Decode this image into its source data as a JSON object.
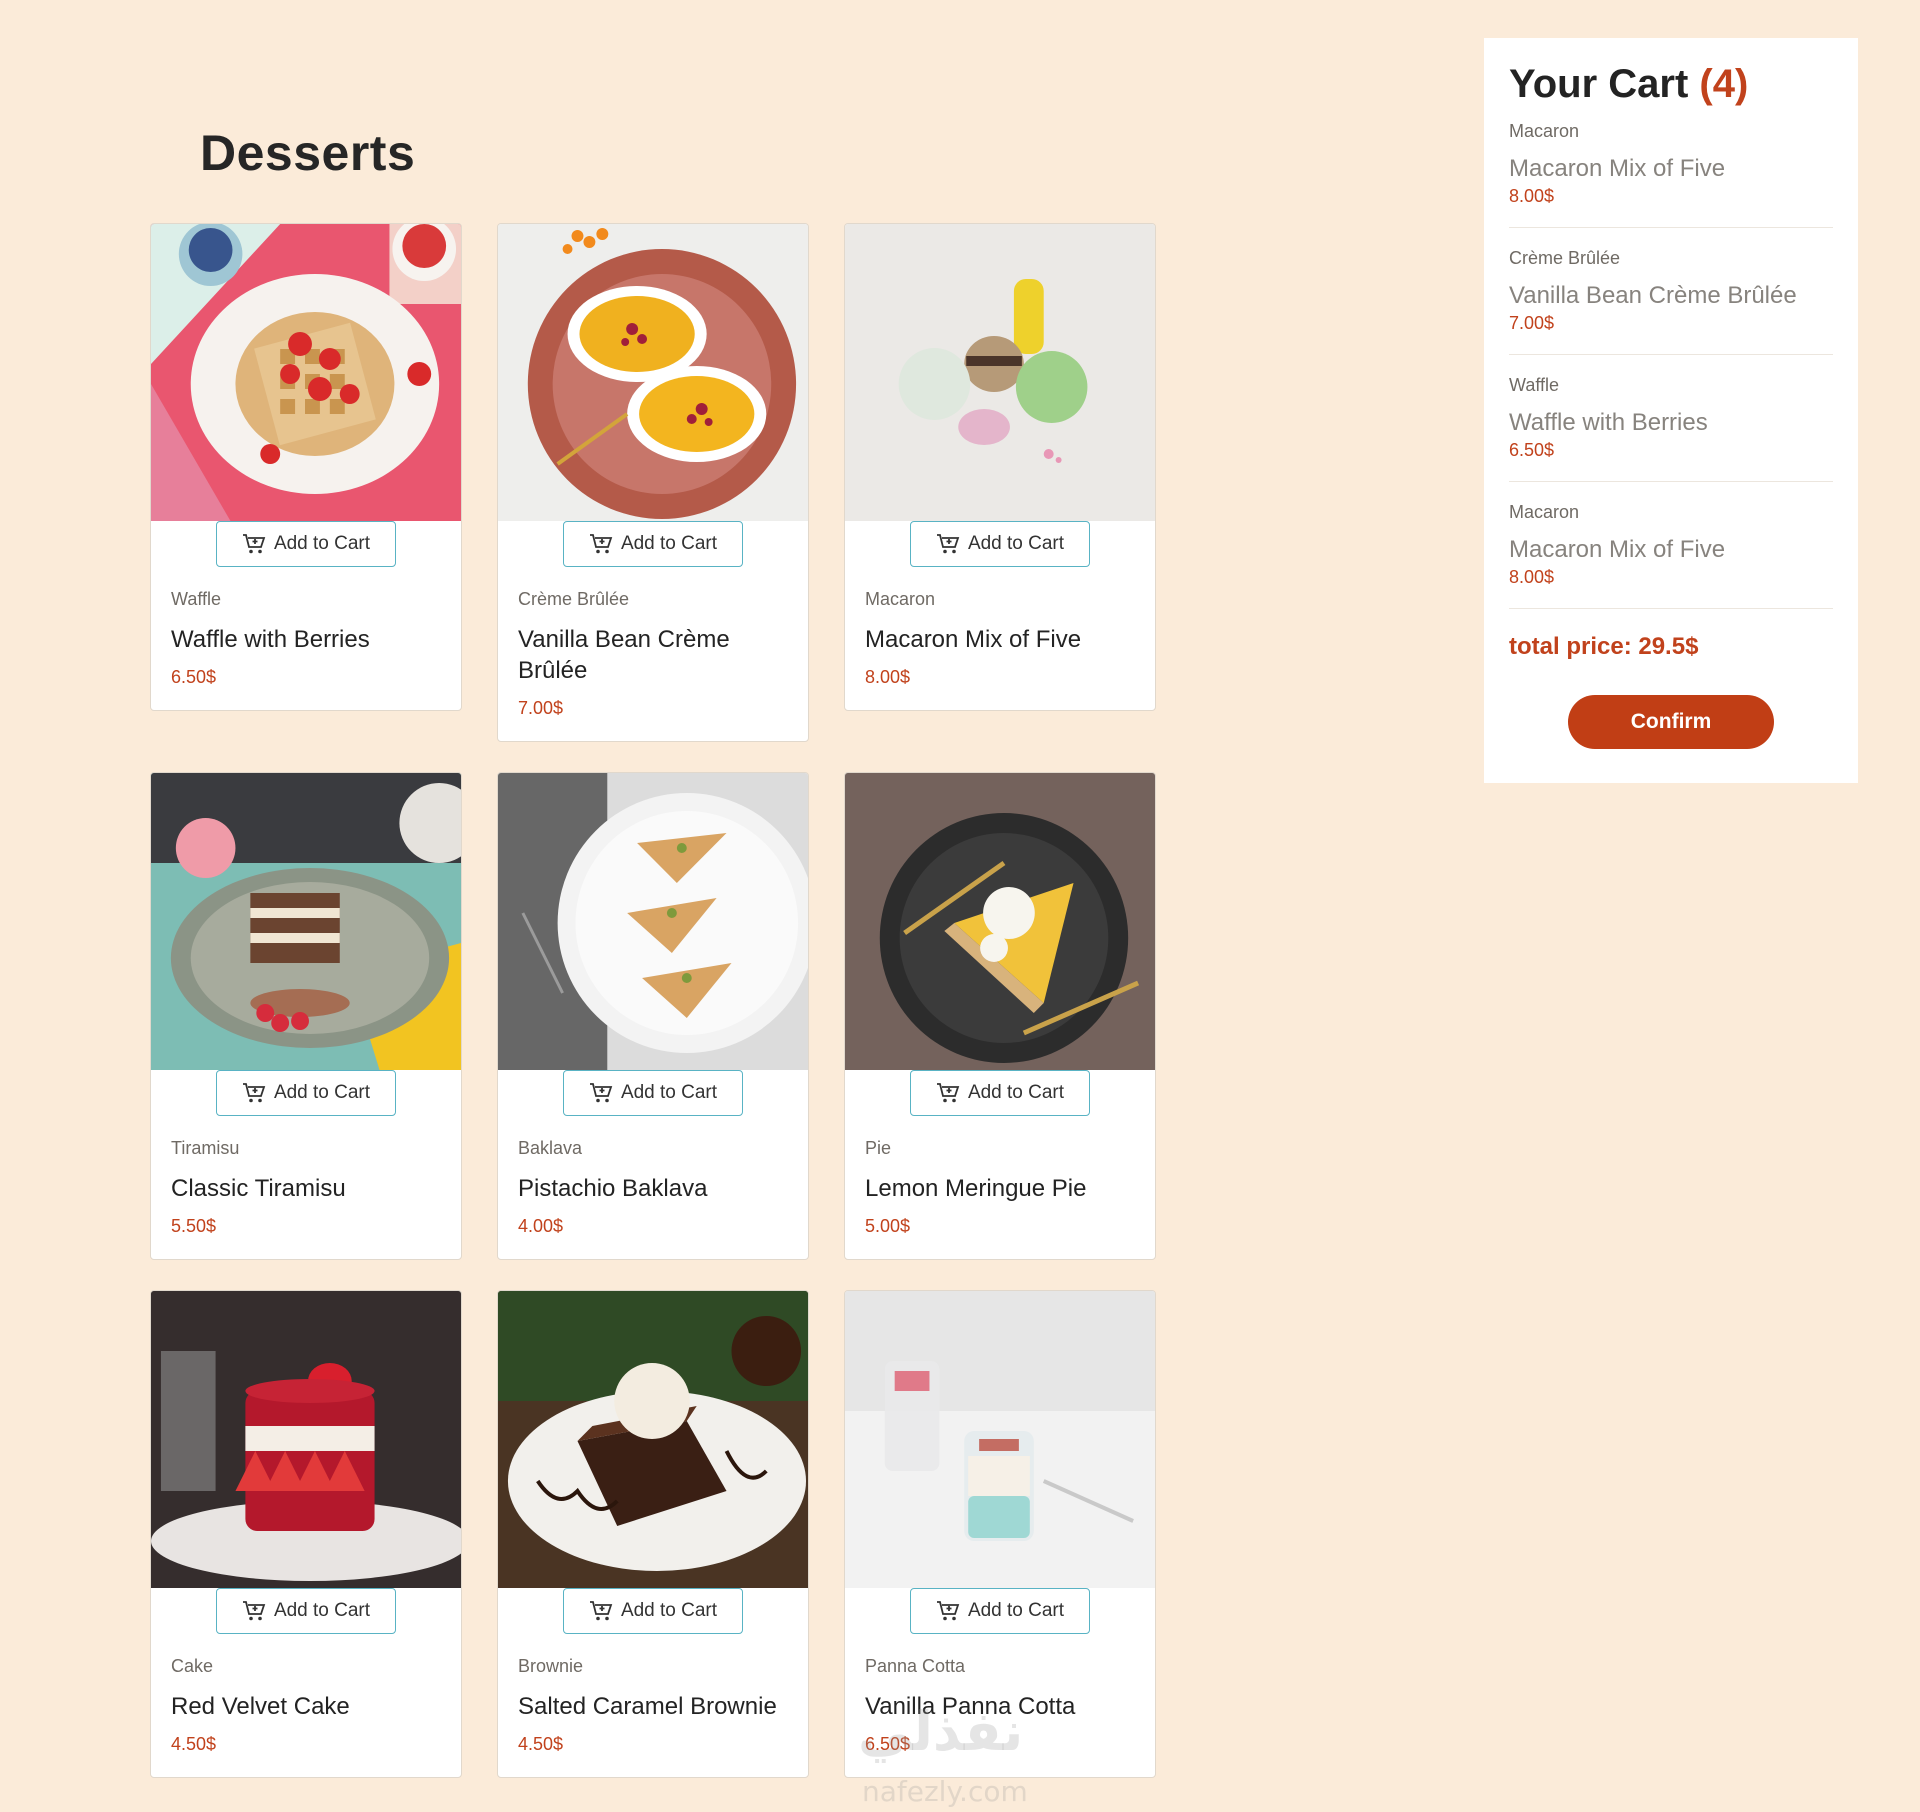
{
  "page": {
    "title": "Desserts"
  },
  "products": [
    {
      "category": "Waffle",
      "name": "Waffle with Berries",
      "price": "6.50$",
      "button": "Add to Cart",
      "image": "waffle-photo"
    },
    {
      "category": "Crème Brûlée",
      "name": "Vanilla Bean Crème Brûlée",
      "price": "7.00$",
      "button": "Add to Cart",
      "image": "creme-brulee-photo"
    },
    {
      "category": "Macaron",
      "name": "Macaron Mix of Five",
      "price": "8.00$",
      "button": "Add to Cart",
      "image": "macaron-photo"
    },
    {
      "category": "Tiramisu",
      "name": "Classic Tiramisu",
      "price": "5.50$",
      "button": "Add to Cart",
      "image": "tiramisu-photo"
    },
    {
      "category": "Baklava",
      "name": "Pistachio Baklava",
      "price": "4.00$",
      "button": "Add to Cart",
      "image": "baklava-photo"
    },
    {
      "category": "Pie",
      "name": "Lemon Meringue Pie",
      "price": "5.00$",
      "button": "Add to Cart",
      "image": "pie-photo"
    },
    {
      "category": "Cake",
      "name": "Red Velvet Cake",
      "price": "4.50$",
      "button": "Add to Cart",
      "image": "cake-photo"
    },
    {
      "category": "Brownie",
      "name": "Salted Caramel Brownie",
      "price": "4.50$",
      "button": "Add to Cart",
      "image": "brownie-photo"
    },
    {
      "category": "Panna Cotta",
      "name": "Vanilla Panna Cotta",
      "price": "6.50$",
      "button": "Add to Cart",
      "image": "panna-cotta-photo"
    }
  ],
  "cart": {
    "title": "Your Cart",
    "count": "(4)",
    "items": [
      {
        "category": "Macaron",
        "name": "Macaron Mix of Five",
        "price": "8.00$"
      },
      {
        "category": "Crème Brûlée",
        "name": "Vanilla Bean Crème Brûlée",
        "price": "7.00$"
      },
      {
        "category": "Waffle",
        "name": "Waffle with Berries",
        "price": "6.50$"
      },
      {
        "category": "Macaron",
        "name": "Macaron Mix of Five",
        "price": "8.00$"
      }
    ],
    "total": "total price: 29.5$",
    "confirm_label": "Confirm"
  },
  "watermark": {
    "text": "نفذلي",
    "sub": "nafezly.com"
  },
  "colors": {
    "background": "#fbebd9",
    "accent": "#c1421c",
    "button_border": "#59b3c4"
  }
}
